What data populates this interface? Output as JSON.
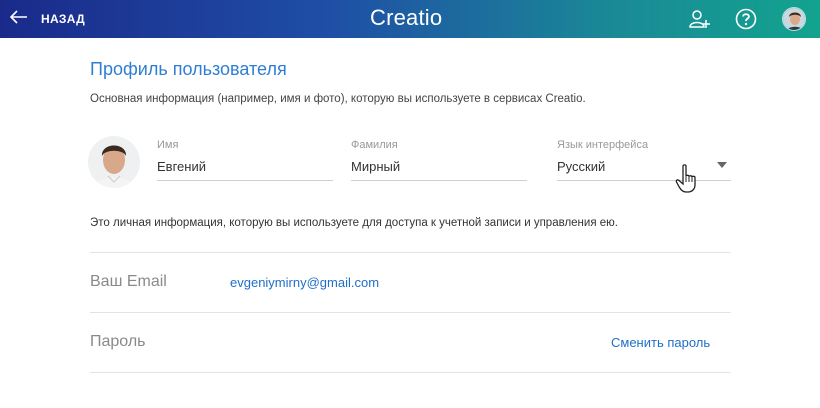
{
  "header": {
    "back_label": "НАЗАД",
    "logo_text": "Creatio",
    "icons": [
      "add-user-icon",
      "help-icon",
      "user-avatar"
    ]
  },
  "profile": {
    "title": "Профиль пользователя",
    "subtitle": "Основная информация (например, имя и фото), которую вы используете в сервисах Creatio.",
    "fields": {
      "first_name": {
        "label": "Имя",
        "value": "Евгений"
      },
      "last_name": {
        "label": "Фамилия",
        "value": "Мирный"
      },
      "language": {
        "label": "Язык интерфейса",
        "value": "Русский"
      }
    }
  },
  "account": {
    "info": "Это личная информация, которую вы используете для доступа к учетной записи и управления ею.",
    "email_label": "Ваш Email",
    "email_value": "evgeniymirny@gmail.com",
    "password_label": "Пароль",
    "change_password_label": "Сменить пароль"
  },
  "colors": {
    "accent": "#2e7ed4",
    "link": "#1f6fc8",
    "header_start": "#1a2a8a",
    "header_end": "#12a38e"
  }
}
